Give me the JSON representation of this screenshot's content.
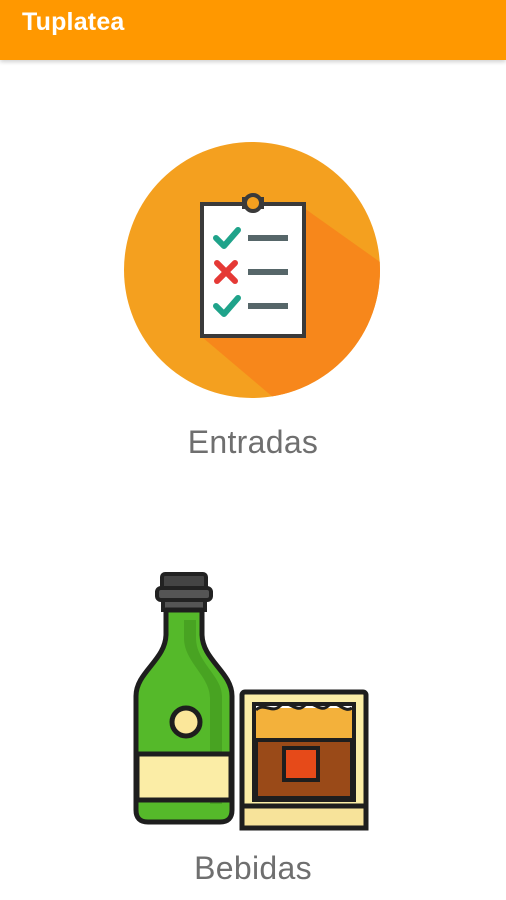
{
  "app": {
    "title": "Tuplatea",
    "accent_color": "#ff9800"
  },
  "menu": {
    "items": [
      {
        "label": "Entradas",
        "icon": "checklist-clipboard-icon"
      },
      {
        "label": "Bebidas",
        "icon": "bottle-and-glass-icon"
      }
    ]
  }
}
